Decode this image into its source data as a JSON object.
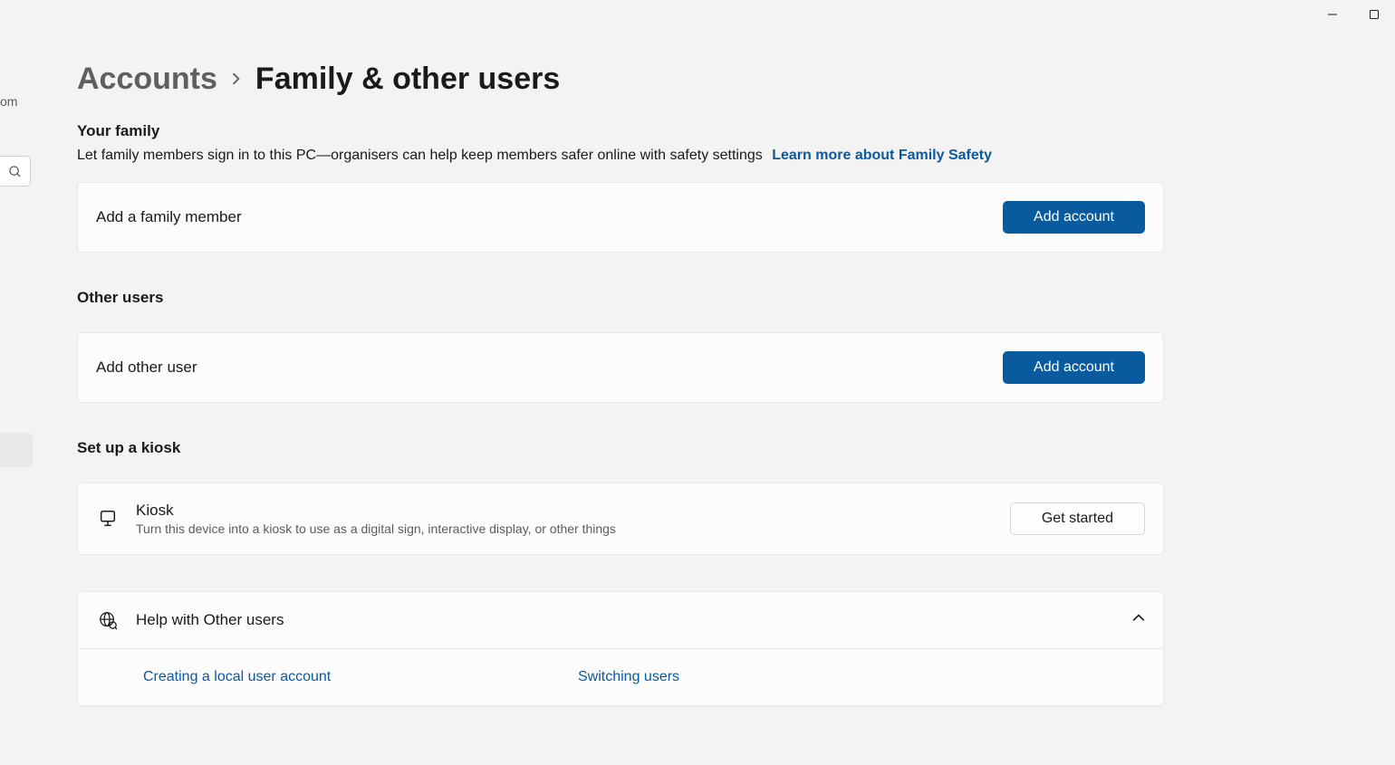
{
  "window": {
    "email_fragment": "om"
  },
  "breadcrumb": {
    "parent": "Accounts",
    "current": "Family & other users"
  },
  "family": {
    "title": "Your family",
    "description": "Let family members sign in to this PC—organisers can help keep members safer online with safety settings",
    "learn_link": "Learn more about Family Safety",
    "add_label": "Add a family member",
    "add_button": "Add account"
  },
  "other": {
    "title": "Other users",
    "add_label": "Add other user",
    "add_button": "Add account"
  },
  "kiosk": {
    "title": "Set up a kiosk",
    "label": "Kiosk",
    "sublabel": "Turn this device into a kiosk to use as a digital sign, interactive display, or other things",
    "button": "Get started"
  },
  "help": {
    "title": "Help with Other users",
    "links": [
      "Creating a local user account",
      "Switching users"
    ]
  }
}
